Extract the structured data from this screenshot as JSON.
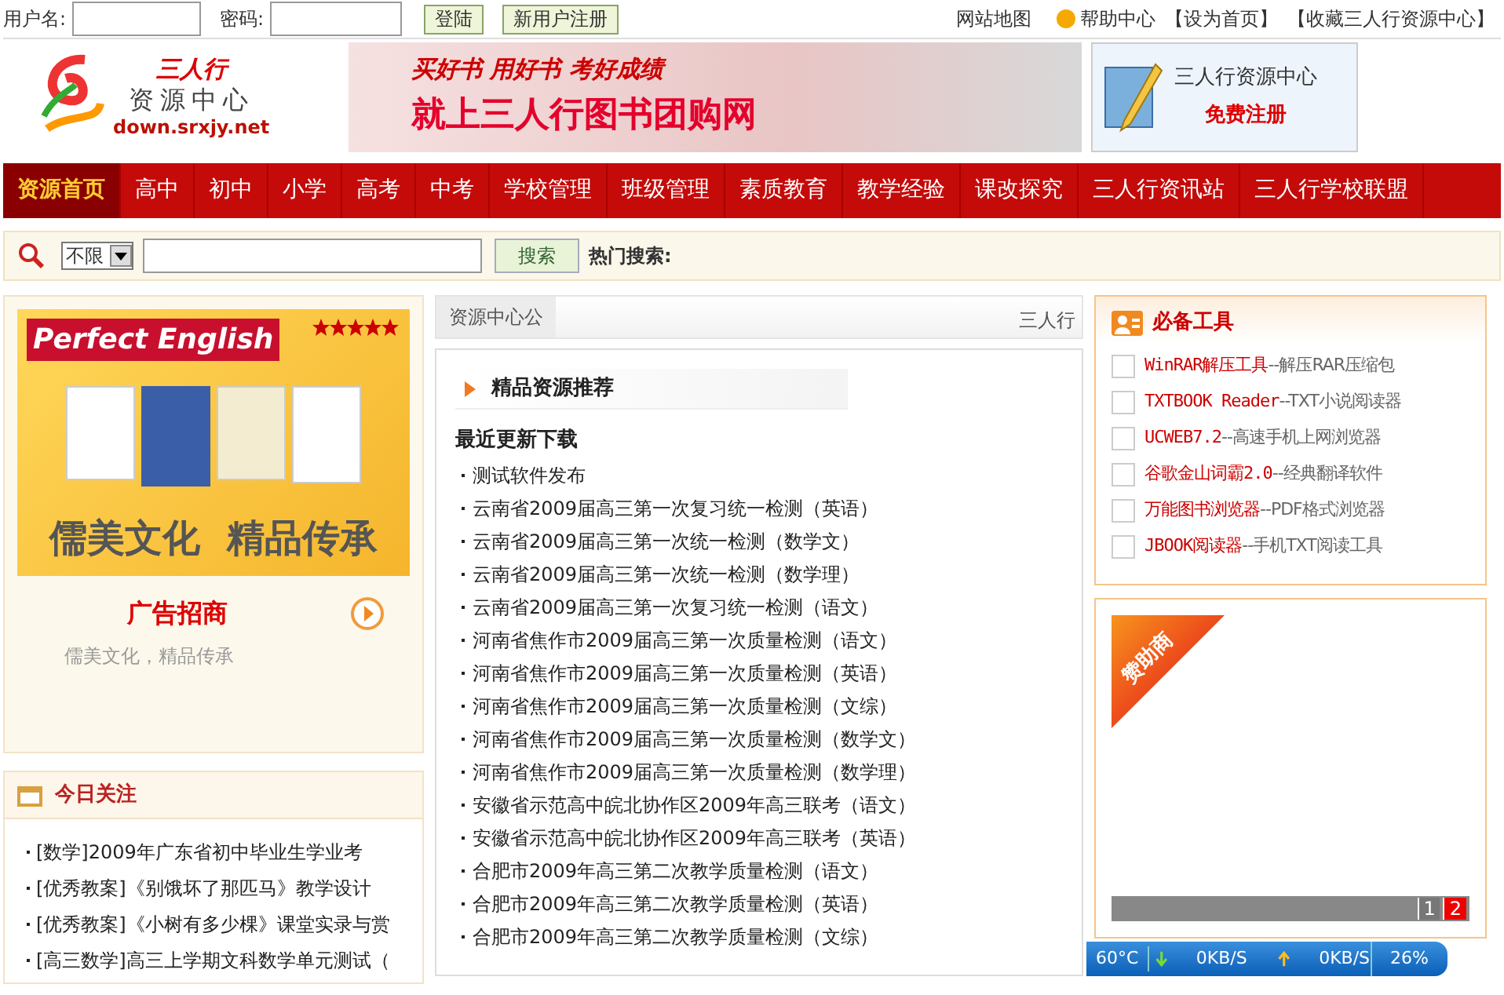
{
  "login": {
    "username_label": "用户名:",
    "password_label": "密码:",
    "login_button": "登陆",
    "register_button": "新用户注册"
  },
  "top_links": [
    {
      "text": "网站地图",
      "kind": "plain"
    },
    {
      "text": "帮助中心",
      "kind": "help"
    },
    {
      "text": "【设为首页】",
      "kind": "plain"
    },
    {
      "text": "【收藏三人行资源中心】",
      "kind": "plain"
    }
  ],
  "logo": {
    "title": "三人行",
    "subtitle": "资源中心",
    "url": "down.srxjy.net"
  },
  "banner": {
    "slogan": "买好书 用好书 考好成绩",
    "headline": "就上三人行图书团购网"
  },
  "register_banner": {
    "title": "三人行资源中心",
    "action": "免费注册"
  },
  "nav": [
    {
      "label": "资源首页",
      "selected": true
    },
    {
      "label": "高中",
      "selected": false
    },
    {
      "label": "初中",
      "selected": false
    },
    {
      "label": "小学",
      "selected": false
    },
    {
      "label": "高考",
      "selected": false
    },
    {
      "label": "中考",
      "selected": false
    },
    {
      "label": "学校管理",
      "selected": false
    },
    {
      "label": "班级管理",
      "selected": false
    },
    {
      "label": "素质教育",
      "selected": false
    },
    {
      "label": "教学经验",
      "selected": false
    },
    {
      "label": "课改探究",
      "selected": false
    },
    {
      "label": "三人行资讯站",
      "selected": false
    },
    {
      "label": "三人行学校联盟",
      "selected": false
    }
  ],
  "search": {
    "scope": "不限",
    "button": "搜索",
    "hot_label": "热门搜索:"
  },
  "ad": {
    "brand": "Perfect English",
    "slogan": "儒美文化  精品传承",
    "title": "广告招商",
    "caption": "儒美文化，精品传承"
  },
  "today": {
    "title": "今日关注",
    "items": [
      "[数学]2009年广东省初中毕业生学业考",
      "[优秀教案]《别饿坏了那匹马》教学设计",
      "[优秀教案]《小树有多少棵》课堂实录与赏",
      "[高三数学]高三上学期文科数学单元测试（"
    ]
  },
  "notice": {
    "tab": "资源中心公",
    "ticker": "三人行"
  },
  "featured": {
    "title": "精品资源推荐",
    "list_title": "最近更新下载",
    "items": [
      "测试软件发布",
      "云南省2009届高三第一次复习统一检测（英语）",
      "云南省2009届高三第一次统一检测（数学文）",
      "云南省2009届高三第一次统一检测（数学理）",
      "云南省2009届高三第一次复习统一检测（语文）",
      "河南省焦作市2009届高三第一次质量检测（语文）",
      "河南省焦作市2009届高三第一次质量检测（英语）",
      "河南省焦作市2009届高三第一次质量检测（文综）",
      "河南省焦作市2009届高三第一次质量检测（数学文）",
      "河南省焦作市2009届高三第一次质量检测（数学理）",
      "安徽省示范高中皖北协作区2009年高三联考（语文）",
      "安徽省示范高中皖北协作区2009年高三联考（英语）",
      "合肥市2009年高三第二次教学质量检测（语文）",
      "合肥市2009年高三第二次教学质量检测（英语）",
      "合肥市2009年高三第二次教学质量检测（文综）"
    ]
  },
  "tools": {
    "title": "必备工具",
    "items": [
      {
        "name": "WinRAR解压工具",
        "desc": "--解压RAR压缩包",
        "checked": false
      },
      {
        "name": "TXTBOOK Reader",
        "desc": "--TXT小说阅读器",
        "checked": false
      },
      {
        "name": "UCWEB7.2",
        "desc": "--高速手机上网浏览器",
        "checked": false
      },
      {
        "name": "谷歌金山词霸2.0",
        "desc": "--经典翻译软件",
        "checked": false
      },
      {
        "name": "万能图书浏览器",
        "desc": "--PDF格式浏览器",
        "checked": false
      },
      {
        "name": "JBOOK阅读器",
        "desc": "--手机TXT阅读工具",
        "checked": false
      }
    ]
  },
  "sponsor": {
    "badge": "赞助商",
    "pages": [
      {
        "label": "1",
        "selected": false
      },
      {
        "label": "2",
        "selected": true
      }
    ]
  },
  "monitor": {
    "temperature": "60°C",
    "download": "0KB/S",
    "upload": "0KB/S",
    "usage": "26%"
  }
}
